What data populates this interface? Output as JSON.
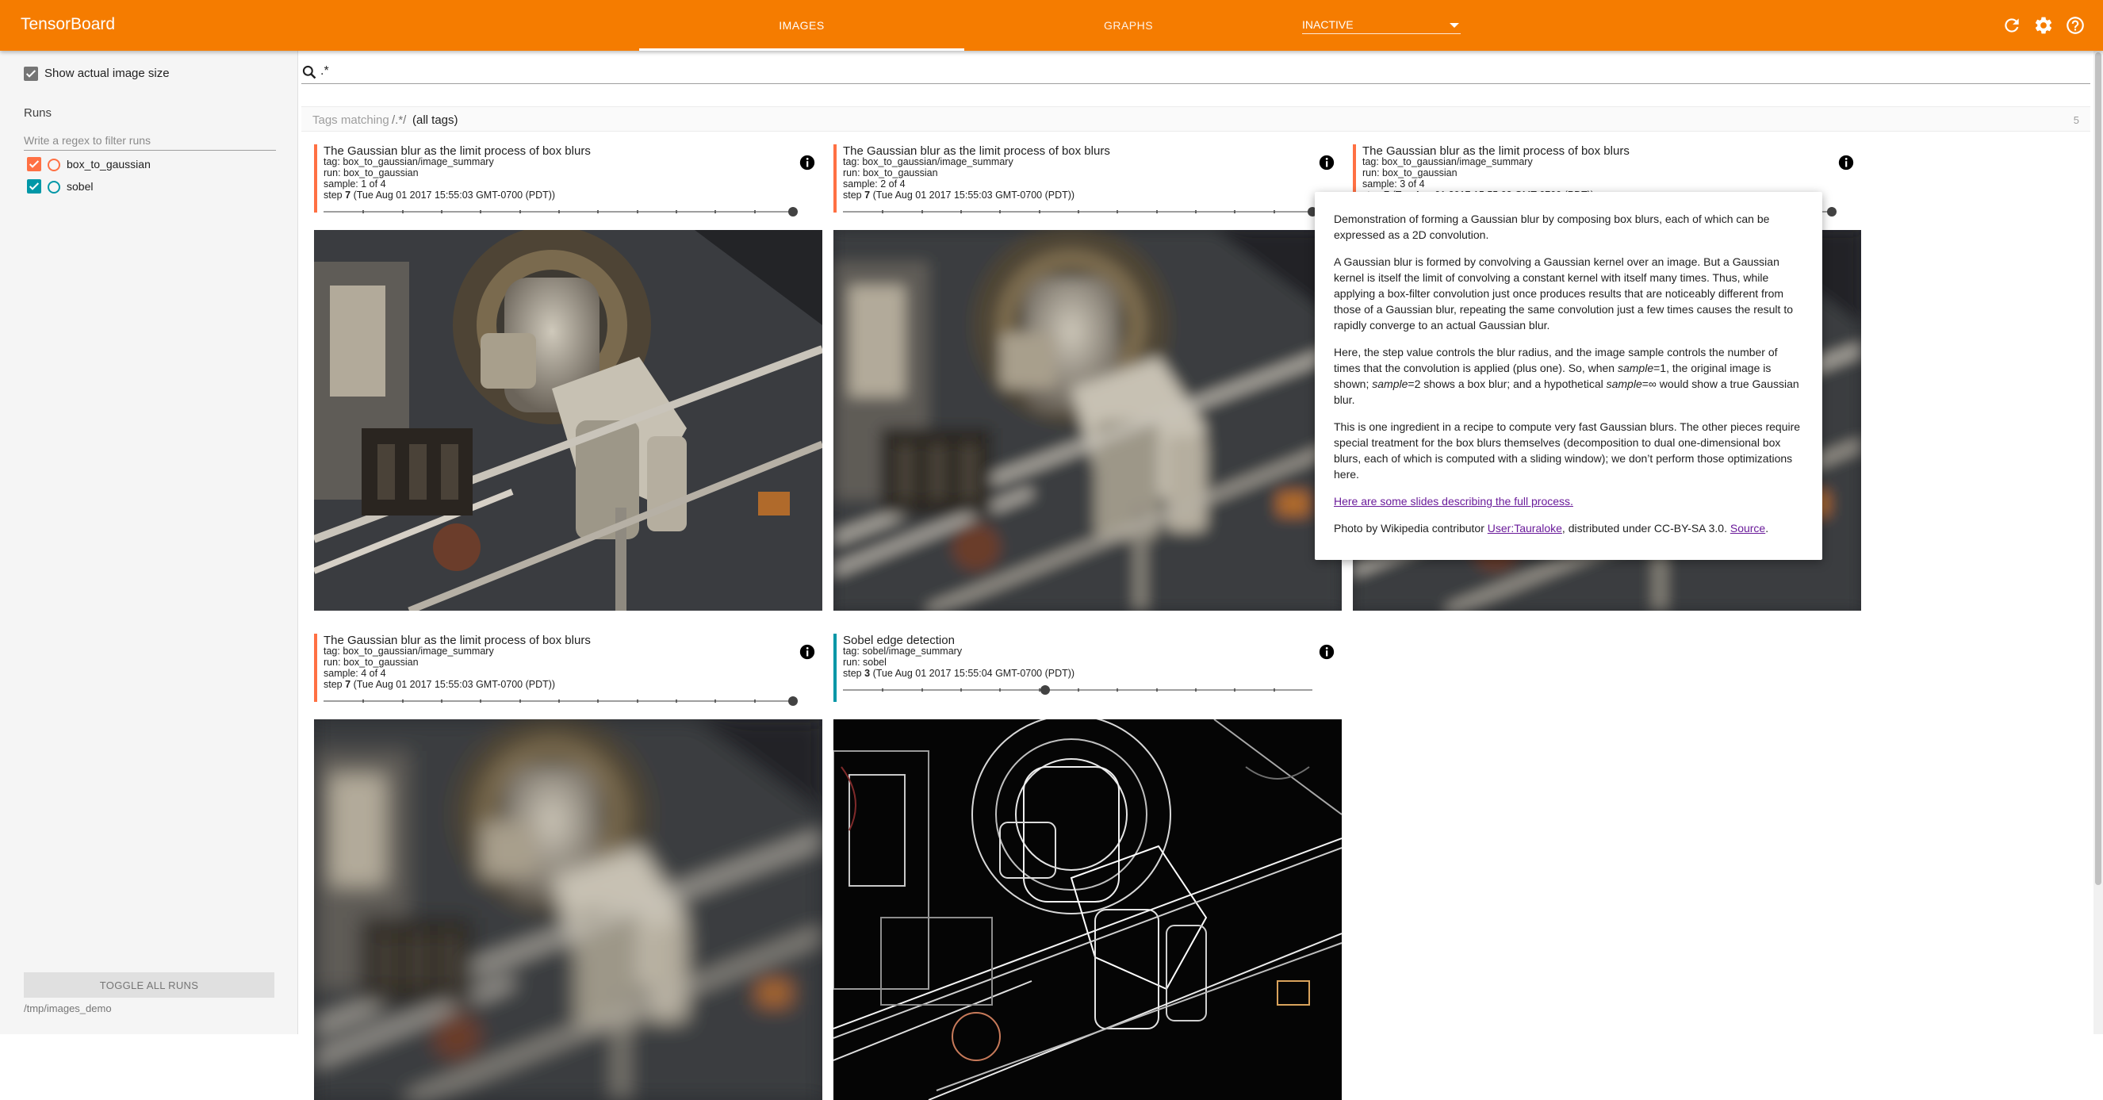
{
  "app": {
    "brand": "TensorBoard"
  },
  "header": {
    "tabs": [
      {
        "label": "IMAGES",
        "active": true
      },
      {
        "label": "GRAPHS",
        "active": false
      }
    ],
    "dropdown_value": "INACTIVE",
    "icons": [
      "refresh-icon",
      "settings-gear-icon",
      "help-icon"
    ]
  },
  "sidebar": {
    "show_actual_size_label": "Show actual image size",
    "show_actual_size_checked": true,
    "runs_title": "Runs",
    "filter_placeholder": "Write a regex to filter runs",
    "runs": [
      {
        "name": "box_to_gaussian",
        "color": "#ff7043",
        "checked": true
      },
      {
        "name": "sobel",
        "color": "#0097a7",
        "checked": true
      }
    ],
    "toggle_label": "TOGGLE ALL RUNS",
    "logdir": "/tmp/images_demo"
  },
  "search": {
    "value": ".*"
  },
  "tags": {
    "label": "Tags matching",
    "pattern": "/.*/",
    "all": "(all tags)",
    "count": "5"
  },
  "cards": [
    {
      "title": "The Gaussian blur as the limit process of box blurs",
      "tag": "tag: box_to_gaussian/image_summary",
      "run": "run: box_to_gaussian",
      "sample": "sample: 1 of 4",
      "step_prefix": "step",
      "step_value": "7",
      "step_time": "(Tue Aug 01 2017 15:55:03 GMT-0700 (PDT))",
      "color": "#ff7043",
      "slider_fraction": 1.0,
      "image": "mechanism-sharp"
    },
    {
      "title": "The Gaussian blur as the limit process of box blurs",
      "tag": "tag: box_to_gaussian/image_summary",
      "run": "run: box_to_gaussian",
      "sample": "sample: 2 of 4",
      "step_prefix": "step",
      "step_value": "7",
      "step_time": "(Tue Aug 01 2017 15:55:03 GMT-0700 (PDT))",
      "color": "#ff7043",
      "slider_fraction": 1.0,
      "image": "mechanism-blur"
    },
    {
      "title": "The Gaussian blur as the limit process of box blurs",
      "tag": "tag: box_to_gaussian/image_summary",
      "run": "run: box_to_gaussian",
      "sample": "sample: 3 of 4",
      "step_prefix": "step",
      "step_value": "7",
      "step_time": "(Tue Aug 01 2017 15:55:03 GMT-0700 (PDT))",
      "color": "#ff7043",
      "slider_fraction": 1.0,
      "image": "mechanism-blur"
    },
    {
      "title": "The Gaussian blur as the limit process of box blurs",
      "tag": "tag: box_to_gaussian/image_summary",
      "run": "run: box_to_gaussian",
      "sample": "sample: 4 of 4",
      "step_prefix": "step",
      "step_value": "7",
      "step_time": "(Tue Aug 01 2017 15:55:03 GMT-0700 (PDT))",
      "color": "#ff7043",
      "slider_fraction": 1.0,
      "image": "mechanism-blur-strong"
    },
    {
      "title": "Sobel edge detection",
      "tag": "tag: sobel/image_summary",
      "run": "run: sobel",
      "sample": "",
      "step_prefix": "step",
      "step_value": "3",
      "step_time": "(Tue Aug 01 2017 15:55:04 GMT-0700 (PDT))",
      "color": "#0097a7",
      "slider_fraction": 0.43,
      "image": "sobel-edges"
    }
  ],
  "popup": {
    "p1": "Demonstration of forming a Gaussian blur by composing box blurs, each of which can be expressed as a 2D convolution.",
    "p2": "A Gaussian blur is formed by convolving a Gaussian kernel over an image. But a Gaussian kernel is itself the limit of convolving a constant kernel with itself many times. Thus, while applying a box-filter convolution just once produces results that are noticeably different from those of a Gaussian blur, repeating the same convolution just a few times causes the result to rapidly converge to an actual Gaussian blur.",
    "p3_a": "Here, the step value controls the blur radius, and the image sample controls the number of times that the convolution is applied (plus one). So, when ",
    "p3_b": "sample",
    "p3_c": "=1, the original image is shown; ",
    "p3_d": "sample",
    "p3_e": "=2 shows a box blur; and a hypothetical ",
    "p3_f": "sample",
    "p3_g": "=∞ would show a true Gaussian blur.",
    "p4": "This is one ingredient in a recipe to compute very fast Gaussian blurs. The other pieces require special treatment for the box blurs themselves (decomposition to dual one-dimensional box blurs, each of which is computed with a sliding window); we don’t perform those optimizations here.",
    "slides_link": "Here are some slides describing the full process.",
    "credit_a": "Photo by Wikipedia contributor ",
    "credit_user": "User:Tauraloke",
    "credit_b": ", distributed under CC-BY-SA 3.0. ",
    "credit_source": "Source",
    "credit_c": "."
  }
}
